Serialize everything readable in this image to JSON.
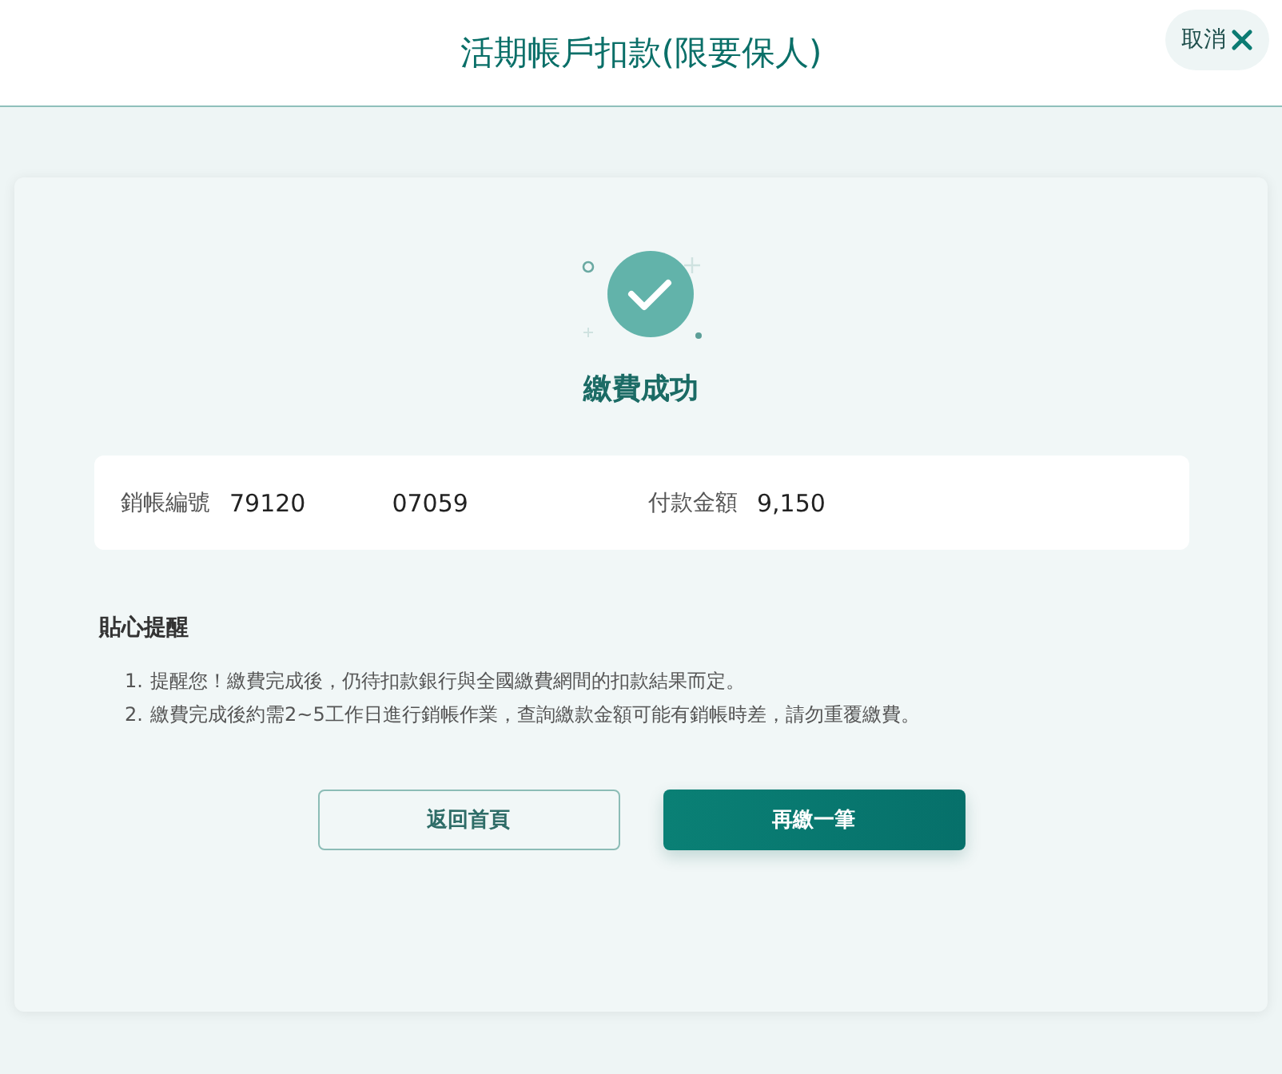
{
  "header": {
    "title": "活期帳戶扣款(限要保人)",
    "cancel_button": "取消"
  },
  "result": {
    "message": "繳費成功"
  },
  "summary": [
    {
      "label": "銷帳編號",
      "values": [
        "79120",
        "07059"
      ]
    },
    {
      "label": "付款金額",
      "values": [
        "9,150"
      ]
    }
  ],
  "notes": {
    "title": "貼心提醒",
    "items": [
      {
        "number": "1.",
        "text": "提醒您！繳費完成後，仍待扣款銀行與全國繳費網間的扣款結果而定。"
      },
      {
        "number": "2.",
        "text": "繳費完成後約需2~5工作日進行銷帳作業，查詢繳款金額可能有銷帳時差，請勿重覆繳費。"
      }
    ]
  },
  "buttons": [
    {
      "label": "返回首頁",
      "kind": "secondary"
    },
    {
      "label": "再繳一筆",
      "kind": "primary"
    }
  ]
}
